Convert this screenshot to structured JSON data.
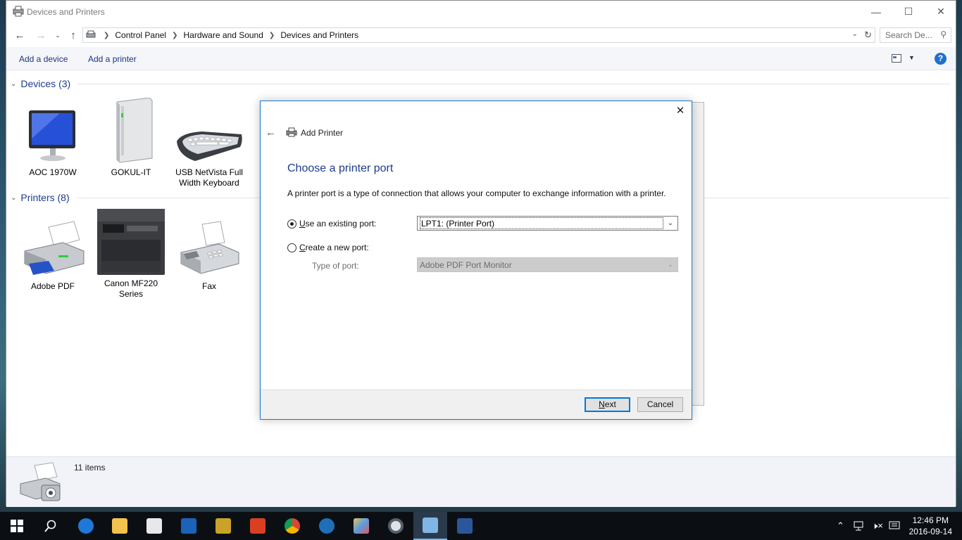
{
  "window": {
    "title": "Devices and Printers",
    "minimize_icon": "minimize-icon",
    "maximize_icon": "maximize-icon",
    "close_icon": "close-icon"
  },
  "address": {
    "breadcrumbs": [
      "Control Panel",
      "Hardware and Sound",
      "Devices and Printers"
    ],
    "search_placeholder": "Search De..."
  },
  "commands": {
    "add_device": "Add a device",
    "add_printer": "Add a printer"
  },
  "devices": {
    "header": "Devices (3)",
    "items": [
      {
        "label": "AOC 1970W",
        "icon": "monitor-icon"
      },
      {
        "label": "GOKUL-IT",
        "icon": "computer-tower-icon"
      },
      {
        "label": "USB NetVista Full Width Keyboard",
        "icon": "keyboard-icon"
      }
    ]
  },
  "printers": {
    "header": "Printers (8)",
    "items": [
      {
        "label": "Adobe PDF",
        "icon": "printer-icon"
      },
      {
        "label": "Canon MF220 Series",
        "icon": "multifunction-printer-icon"
      },
      {
        "label": "Fax",
        "icon": "fax-icon"
      }
    ]
  },
  "status": {
    "count": "11 items"
  },
  "dialog": {
    "title": "Add Printer",
    "heading": "Choose a printer port",
    "description": "A printer port is a type of connection that allows your computer to exchange information with a printer.",
    "existing_port_label": "Use an existing port:",
    "existing_port_value": "LPT1: (Printer Port)",
    "new_port_label": "Create a new port:",
    "type_of_port_label": "Type of port:",
    "type_of_port_value": "Adobe PDF Port Monitor",
    "next_label": "Next",
    "cancel_label": "Cancel",
    "selected_option": "existing"
  },
  "taskbar": {
    "time": "12:46 PM",
    "date": "2016-09-14",
    "apps": [
      "start",
      "search",
      "edge",
      "file-explorer",
      "store",
      "outlook",
      "tools",
      "app-red",
      "chrome",
      "app-blue",
      "paint",
      "app-circle",
      "devices-and-printers",
      "word"
    ]
  },
  "colors": {
    "accent": "#0078d7",
    "heading_blue": "#1e3c8c",
    "taskbar": "#0b0f14"
  }
}
